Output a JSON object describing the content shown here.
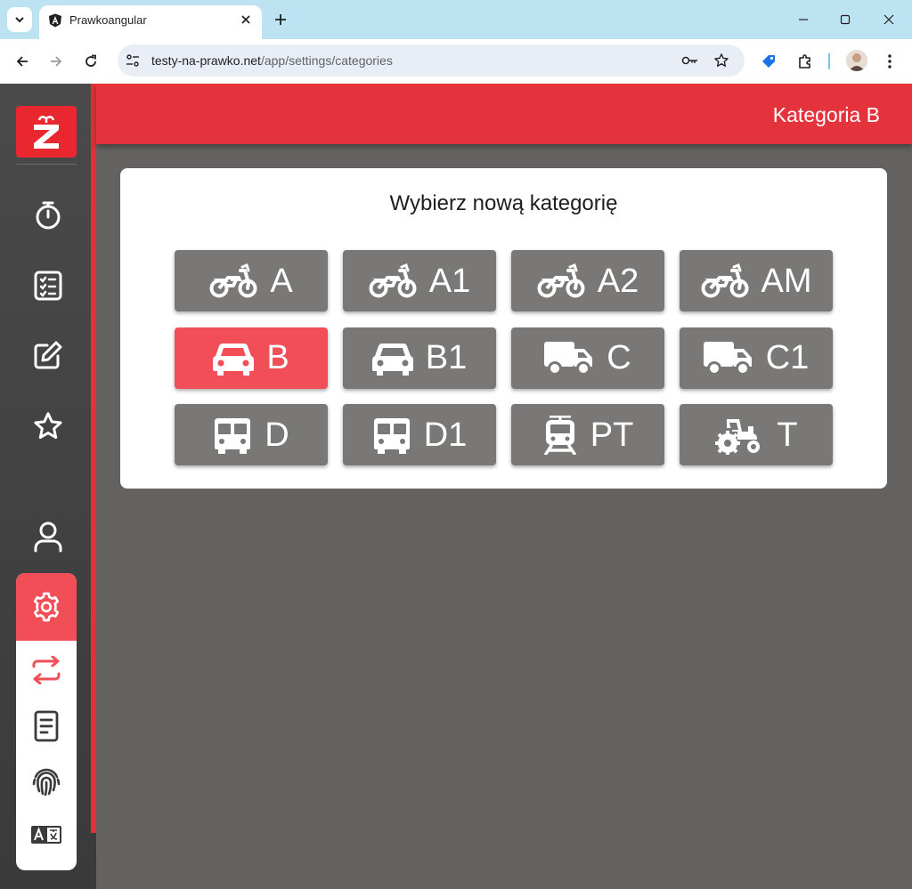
{
  "browser": {
    "tab_title": "Prawkoangular",
    "url_host": "testy-na-prawko.net",
    "url_path": "/app/settings/categories"
  },
  "header": {
    "title": "Kategoria B"
  },
  "card": {
    "title": "Wybierz nową kategorię"
  },
  "categories": [
    {
      "label": "A",
      "icon": "motorcycle-icon"
    },
    {
      "label": "A1",
      "icon": "motorcycle-icon"
    },
    {
      "label": "A2",
      "icon": "motorcycle-icon"
    },
    {
      "label": "AM",
      "icon": "motorcycle-icon"
    },
    {
      "label": "B",
      "icon": "car-icon",
      "selected": true
    },
    {
      "label": "B1",
      "icon": "car-icon"
    },
    {
      "label": "C",
      "icon": "truck-icon"
    },
    {
      "label": "C1",
      "icon": "truck-icon"
    },
    {
      "label": "D",
      "icon": "bus-icon"
    },
    {
      "label": "D1",
      "icon": "bus-icon"
    },
    {
      "label": "PT",
      "icon": "train-icon"
    },
    {
      "label": "T",
      "icon": "tractor-icon"
    }
  ],
  "colors": {
    "accent": "#e5333d",
    "selected": "#f24e57",
    "button": "#7a7877",
    "background": "#646260"
  }
}
